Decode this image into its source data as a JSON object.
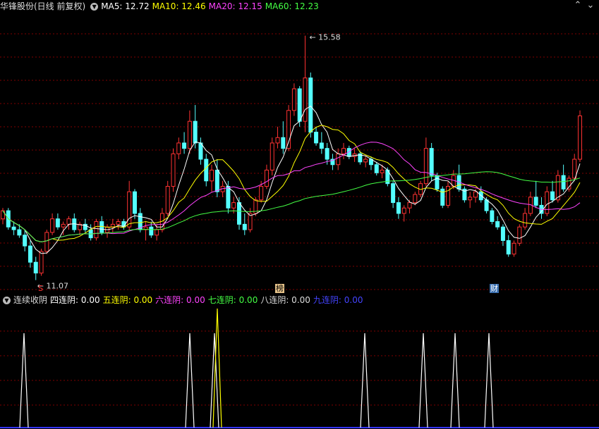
{
  "header": {
    "stock_title": "华锋股份(日线 前复权)",
    "ma_items": [
      {
        "label": "MA5: 12.72",
        "color": "#ffffff"
      },
      {
        "label": "MA10: 12.46",
        "color": "#ffff00"
      },
      {
        "label": "MA20: 12.15",
        "color": "#ff44ff"
      },
      {
        "label": "MA60: 12.23",
        "color": "#44ff44"
      }
    ],
    "window_controls": {
      "up": "⌃",
      "down": "⌄"
    }
  },
  "price_chart": {
    "high_label": "15.58",
    "low_label": "11.07",
    "markers": {
      "s": "S",
      "bang": "榜",
      "cai": "财"
    }
  },
  "indicator": {
    "name": "连续收阴",
    "items": [
      {
        "label": "四连阴: 0.00",
        "color": "#ffffff"
      },
      {
        "label": "五连阴: 0.00",
        "color": "#ffff00"
      },
      {
        "label": "六连阴: 0.00",
        "color": "#ff44ff"
      },
      {
        "label": "七连阴: 0.00",
        "color": "#44ff44"
      },
      {
        "label": "八连阴: 0.00",
        "color": "#dddddd"
      },
      {
        "label": "九连阴: 0.00",
        "color": "#4444ff"
      }
    ]
  },
  "colors": {
    "up": "#ff3232",
    "down": "#54ffff",
    "grid": "#800000"
  },
  "chart_data": {
    "type": "candlestick",
    "ylim": [
      11.0,
      15.9
    ],
    "candles": [
      [
        12.2,
        12.4,
        12.1,
        12.35
      ],
      [
        12.35,
        12.4,
        12.0,
        12.05
      ],
      [
        12.05,
        12.15,
        11.9,
        12.0
      ],
      [
        12.0,
        12.1,
        11.85,
        11.9
      ],
      [
        11.9,
        12.0,
        11.6,
        11.7
      ],
      [
        11.7,
        11.8,
        11.3,
        11.4
      ],
      [
        11.4,
        11.5,
        11.07,
        11.2
      ],
      [
        11.2,
        11.65,
        11.15,
        11.6
      ],
      [
        11.6,
        12.0,
        11.55,
        11.95
      ],
      [
        11.95,
        12.3,
        11.9,
        12.2
      ],
      [
        12.2,
        12.3,
        12.0,
        12.05
      ],
      [
        12.05,
        12.15,
        11.9,
        12.1
      ],
      [
        12.1,
        12.25,
        12.0,
        12.2
      ],
      [
        12.2,
        12.3,
        11.95,
        12.0
      ],
      [
        12.0,
        12.15,
        11.9,
        12.1
      ],
      [
        12.1,
        12.2,
        11.95,
        12.0
      ],
      [
        12.0,
        12.1,
        11.8,
        11.85
      ],
      [
        11.85,
        12.2,
        11.8,
        12.15
      ],
      [
        12.15,
        12.25,
        11.9,
        11.95
      ],
      [
        11.95,
        12.1,
        11.85,
        12.05
      ],
      [
        12.05,
        12.2,
        11.95,
        12.1
      ],
      [
        12.1,
        12.2,
        12.0,
        12.15
      ],
      [
        12.15,
        12.2,
        12.0,
        12.05
      ],
      [
        12.05,
        12.9,
        12.0,
        12.7
      ],
      [
        12.7,
        12.75,
        12.2,
        12.3
      ],
      [
        12.3,
        12.4,
        11.95,
        12.0
      ],
      [
        12.0,
        12.15,
        11.8,
        12.05
      ],
      [
        12.05,
        12.15,
        11.85,
        11.9
      ],
      [
        11.9,
        12.1,
        11.8,
        12.0
      ],
      [
        12.0,
        12.4,
        11.95,
        12.3
      ],
      [
        12.3,
        12.9,
        12.25,
        12.8
      ],
      [
        12.8,
        13.5,
        12.7,
        13.4
      ],
      [
        13.4,
        13.7,
        13.3,
        13.6
      ],
      [
        13.6,
        13.8,
        13.4,
        13.5
      ],
      [
        13.5,
        14.2,
        13.4,
        14.0
      ],
      [
        14.0,
        14.3,
        13.5,
        13.6
      ],
      [
        13.6,
        13.7,
        13.2,
        13.3
      ],
      [
        13.3,
        13.4,
        12.8,
        12.9
      ],
      [
        12.9,
        13.2,
        12.7,
        13.1
      ],
      [
        13.1,
        13.3,
        12.6,
        12.7
      ],
      [
        12.7,
        12.9,
        12.6,
        12.8
      ],
      [
        12.8,
        12.9,
        12.3,
        12.4
      ],
      [
        12.4,
        12.6,
        12.3,
        12.5
      ],
      [
        12.5,
        12.6,
        12.0,
        12.1
      ],
      [
        12.1,
        12.3,
        11.9,
        12.0
      ],
      [
        12.0,
        12.4,
        11.95,
        12.3
      ],
      [
        12.3,
        12.6,
        12.25,
        12.55
      ],
      [
        12.55,
        12.9,
        12.5,
        12.8
      ],
      [
        12.8,
        13.2,
        12.75,
        13.1
      ],
      [
        13.1,
        13.7,
        13.0,
        13.6
      ],
      [
        13.6,
        13.9,
        13.5,
        13.7
      ],
      [
        13.7,
        14.0,
        13.4,
        13.5
      ],
      [
        13.5,
        14.3,
        13.45,
        14.2
      ],
      [
        14.2,
        14.7,
        14.1,
        14.6
      ],
      [
        14.6,
        14.65,
        13.9,
        14.0
      ],
      [
        14.0,
        15.58,
        13.8,
        14.8
      ],
      [
        14.8,
        14.9,
        13.7,
        13.8
      ],
      [
        13.8,
        13.9,
        13.55,
        13.6
      ],
      [
        13.6,
        13.8,
        13.4,
        13.5
      ],
      [
        13.5,
        13.6,
        13.2,
        13.3
      ],
      [
        13.3,
        13.4,
        13.1,
        13.2
      ],
      [
        13.2,
        13.5,
        13.1,
        13.4
      ],
      [
        13.4,
        13.6,
        13.3,
        13.5
      ],
      [
        13.5,
        13.55,
        13.3,
        13.35
      ],
      [
        13.35,
        13.5,
        13.25,
        13.4
      ],
      [
        13.4,
        13.45,
        13.2,
        13.25
      ],
      [
        13.25,
        13.35,
        13.15,
        13.3
      ],
      [
        13.3,
        13.35,
        13.1,
        13.2
      ],
      [
        13.2,
        13.25,
        13.0,
        13.05
      ],
      [
        13.05,
        13.2,
        12.95,
        13.1
      ],
      [
        13.1,
        13.15,
        12.8,
        12.85
      ],
      [
        12.85,
        12.9,
        12.4,
        12.5
      ],
      [
        12.5,
        12.6,
        12.2,
        12.3
      ],
      [
        12.3,
        12.45,
        12.15,
        12.4
      ],
      [
        12.4,
        12.55,
        12.3,
        12.5
      ],
      [
        12.5,
        12.7,
        12.45,
        12.65
      ],
      [
        12.65,
        12.9,
        12.6,
        12.85
      ],
      [
        12.85,
        13.7,
        12.8,
        13.5
      ],
      [
        13.5,
        13.6,
        12.9,
        13.0
      ],
      [
        13.0,
        13.05,
        12.7,
        12.75
      ],
      [
        12.75,
        12.8,
        12.4,
        12.45
      ],
      [
        12.45,
        12.9,
        12.4,
        12.8
      ],
      [
        12.8,
        13.1,
        12.75,
        13.0
      ],
      [
        13.0,
        13.2,
        12.7,
        12.75
      ],
      [
        12.75,
        12.8,
        12.5,
        12.55
      ],
      [
        12.55,
        12.7,
        12.4,
        12.6
      ],
      [
        12.6,
        12.75,
        12.5,
        12.7
      ],
      [
        12.7,
        12.8,
        12.5,
        12.55
      ],
      [
        12.55,
        12.6,
        12.3,
        12.35
      ],
      [
        12.35,
        12.4,
        12.1,
        12.15
      ],
      [
        12.15,
        12.25,
        12.0,
        12.05
      ],
      [
        12.05,
        12.1,
        11.7,
        11.8
      ],
      [
        11.8,
        11.9,
        11.5,
        11.55
      ],
      [
        11.55,
        11.8,
        11.5,
        11.75
      ],
      [
        11.75,
        12.1,
        11.7,
        12.05
      ],
      [
        12.05,
        12.4,
        12.0,
        12.3
      ],
      [
        12.3,
        12.7,
        12.25,
        12.6
      ],
      [
        12.6,
        12.9,
        12.4,
        12.45
      ],
      [
        12.45,
        12.6,
        12.2,
        12.3
      ],
      [
        12.3,
        12.8,
        12.25,
        12.7
      ],
      [
        12.7,
        12.9,
        12.5,
        12.55
      ],
      [
        12.55,
        13.1,
        12.5,
        13.0
      ],
      [
        13.0,
        13.2,
        12.7,
        12.75
      ],
      [
        12.75,
        13.0,
        12.7,
        12.95
      ],
      [
        12.95,
        13.4,
        12.9,
        13.3
      ],
      [
        13.3,
        14.2,
        13.25,
        14.1
      ]
    ]
  }
}
